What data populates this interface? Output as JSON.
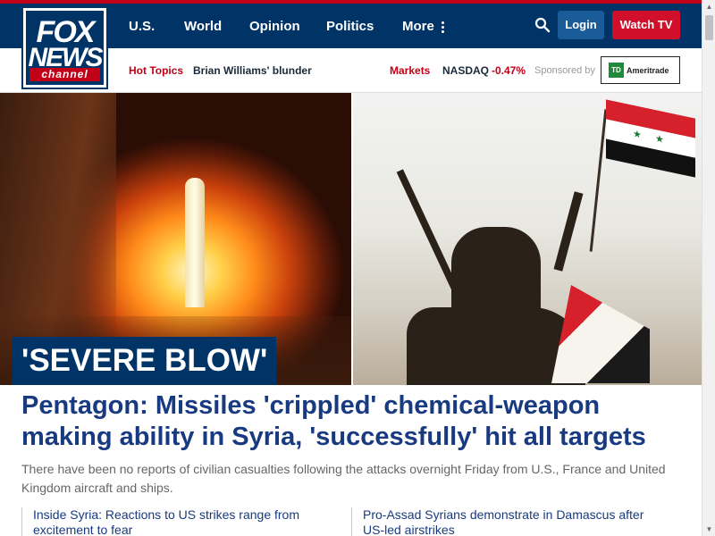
{
  "header": {
    "logo": {
      "line1": "FOX",
      "line2": "NEWS",
      "line3": "channel"
    },
    "nav": [
      {
        "label": "U.S."
      },
      {
        "label": "World"
      },
      {
        "label": "Opinion"
      },
      {
        "label": "Politics"
      },
      {
        "label": "More"
      }
    ],
    "login_label": "Login",
    "watch_label": "Watch TV"
  },
  "subbar": {
    "hot_topics_label": "Hot Topics",
    "hot_topic_item": "Brian Williams' blunder",
    "markets_label": "Markets",
    "index_name": "NASDAQ",
    "index_change": "-0.47%",
    "sponsored_label": "Sponsored by",
    "sponsor_logo_text": "TD",
    "sponsor_name": "Ameritrade"
  },
  "hero": {
    "kicker": "'SEVERE BLOW'"
  },
  "article": {
    "headline": "Pentagon: Missiles 'crippled' chemical-weapon making ability in Syria, 'successfully' hit all targets",
    "dek": "There have been no reports of civilian casualties following the attacks overnight Friday from U.S., France and United Kingdom aircraft and ships.",
    "related": [
      {
        "title": "Inside Syria: Reactions to US strikes range from excitement to fear"
      },
      {
        "title": "Pro-Assad Syrians demonstrate in Damascus after US-led airstrikes"
      }
    ]
  },
  "colors": {
    "brand_navy": "#003366",
    "brand_red": "#c20017",
    "headline_blue": "#183a80",
    "negative": "#c20017"
  },
  "icons": {
    "search": "search-icon",
    "more": "vertical-dots-icon"
  }
}
